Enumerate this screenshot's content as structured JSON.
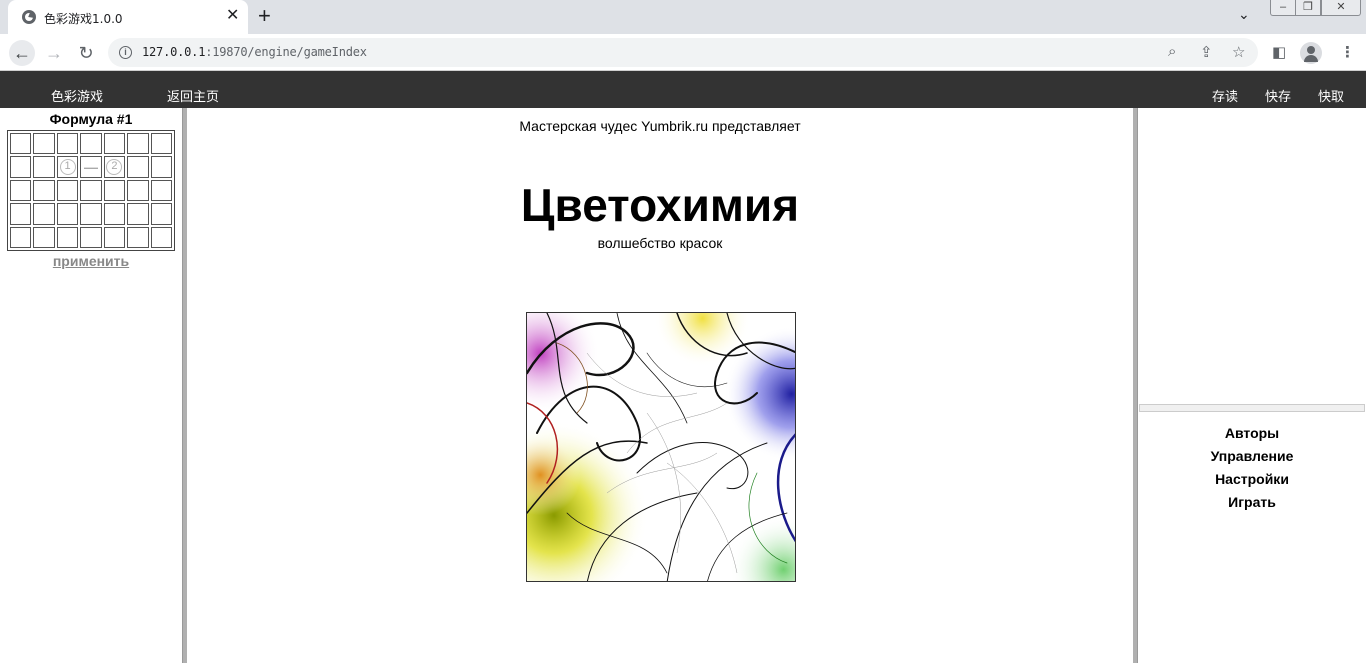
{
  "browser": {
    "tab_title": "色彩游戏1.0.0",
    "url_host": "127.0.0.1",
    "url_rest": ":19870/engine/gameIndex"
  },
  "menubar": {
    "left": [
      "色彩游戏",
      "返回主页"
    ],
    "right": [
      "存读",
      "快存",
      "快取"
    ]
  },
  "formula": {
    "title": "Формула #1",
    "grid": {
      "rows": 5,
      "cols": 7,
      "filled": [
        {
          "row": 1,
          "col": 2,
          "kind": "num",
          "text": "1"
        },
        {
          "row": 1,
          "col": 3,
          "kind": "op",
          "text": "—"
        },
        {
          "row": 1,
          "col": 4,
          "kind": "num",
          "text": "2"
        }
      ]
    },
    "apply": "применить"
  },
  "center": {
    "presents": "Мастерская чудес Yumbrik.ru представляет",
    "title": "Цветохимия",
    "subtitle": "волшебство красок"
  },
  "right_menu": [
    "Авторы",
    "Управление",
    "Настройки",
    "Играть"
  ],
  "colors": {
    "menubar_bg": "#333333",
    "divider": "#b0b0b0"
  }
}
